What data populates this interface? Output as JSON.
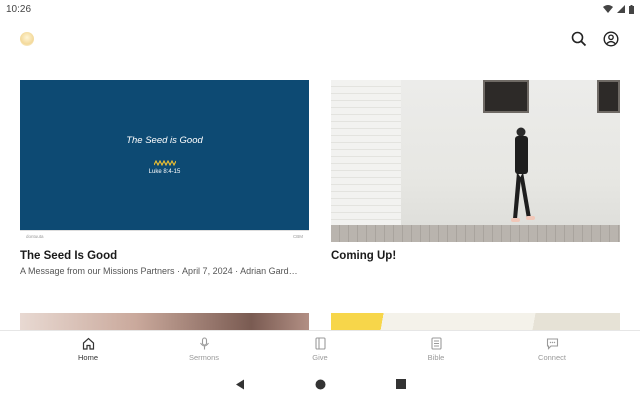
{
  "status": {
    "time": "10:26"
  },
  "cards": [
    {
      "image": {
        "overlay_title": "The Seed is Good",
        "overlay_ref": "Luke 8:4-15",
        "footer_left": "dontuuta",
        "footer_right": "CBM"
      },
      "title": "The Seed Is Good",
      "subtitle": "A Message from our Missions Partners · April 7, 2024 · Adrian Gard…"
    },
    {
      "title": "Coming Up!",
      "subtitle": ""
    }
  ],
  "nav": [
    {
      "label": "Home",
      "icon": "home-icon",
      "active": true
    },
    {
      "label": "Sermons",
      "icon": "microphone-icon",
      "active": false
    },
    {
      "label": "Give",
      "icon": "give-icon",
      "active": false
    },
    {
      "label": "Bible",
      "icon": "bible-icon",
      "active": false
    },
    {
      "label": "Connect",
      "icon": "chat-icon",
      "active": false
    }
  ],
  "colors": {
    "seed_card_bg": "#0d4a73",
    "accent_zigzag": "#f2c230"
  }
}
